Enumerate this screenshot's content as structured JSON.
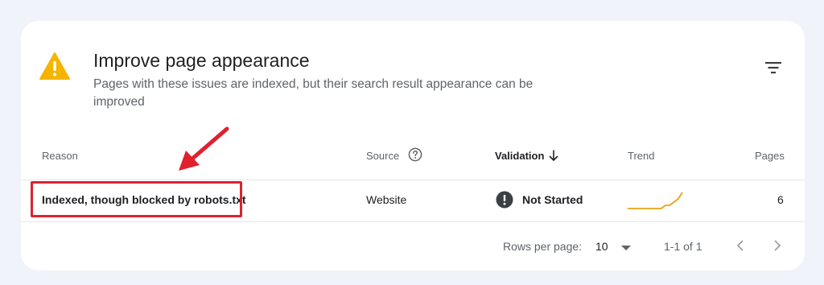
{
  "panel": {
    "title": "Improve page appearance",
    "subtitle": "Pages with these issues are indexed, but their search result appearance can be improved",
    "warning_icon": "warning-triangle-icon",
    "filter_icon": "filter-icon"
  },
  "table": {
    "columns": {
      "reason": "Reason",
      "source": "Source",
      "validation": "Validation",
      "trend": "Trend",
      "pages": "Pages"
    },
    "rows": [
      {
        "reason": "Indexed, though blocked by robots.txt",
        "source": "Website",
        "validation": "Not Started",
        "pages": "6",
        "trend_points": [
          0,
          0,
          0,
          0,
          0,
          0,
          0,
          0,
          0,
          1,
          1,
          2,
          3,
          5
        ]
      }
    ]
  },
  "pagination": {
    "rows_per_page_label": "Rows per page:",
    "rows_per_page_value": "10",
    "range": "1-1 of 1"
  },
  "colors": {
    "accent_warning": "#f5b400",
    "annotation_red": "#e0202f",
    "trend_line": "#e8a317",
    "status_icon": "#3c4043"
  }
}
